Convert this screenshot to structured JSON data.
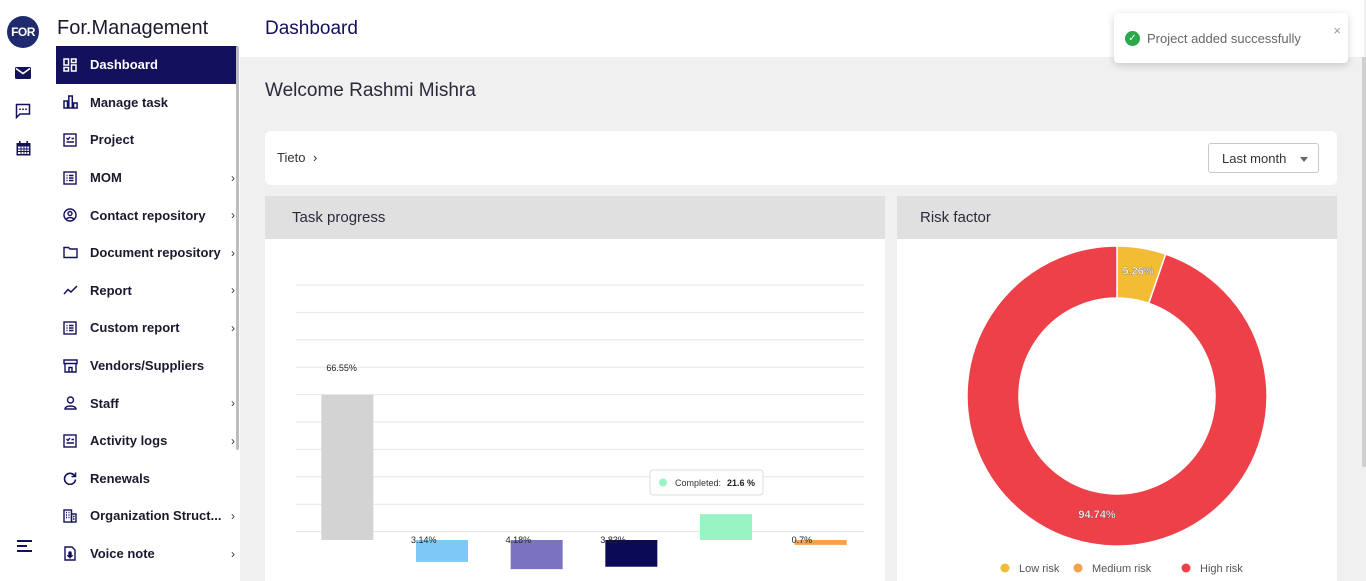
{
  "rail": {
    "logo": "FOR",
    "icons": [
      "mail-icon",
      "chat-icon",
      "calendar-icon",
      "menu-icon"
    ]
  },
  "app": {
    "name": "For.Management"
  },
  "sidebar": {
    "items": [
      {
        "label": "Dashboard",
        "icon": "dashboard-icon",
        "active": true,
        "chevron": false
      },
      {
        "label": "Manage task",
        "icon": "bar-chart-icon",
        "active": false,
        "chevron": false
      },
      {
        "label": "Project",
        "icon": "checklist-icon",
        "active": false,
        "chevron": false
      },
      {
        "label": "MOM",
        "icon": "list-icon",
        "active": false,
        "chevron": true
      },
      {
        "label": "Contact repository",
        "icon": "contact-icon",
        "active": false,
        "chevron": true
      },
      {
        "label": "Document repository",
        "icon": "folder-icon",
        "active": false,
        "chevron": true
      },
      {
        "label": "Report",
        "icon": "trend-icon",
        "active": false,
        "chevron": true
      },
      {
        "label": "Custom report",
        "icon": "list-icon",
        "active": false,
        "chevron": true
      },
      {
        "label": "Vendors/Suppliers",
        "icon": "store-icon",
        "active": false,
        "chevron": false
      },
      {
        "label": "Staff",
        "icon": "person-icon",
        "active": false,
        "chevron": true
      },
      {
        "label": "Activity logs",
        "icon": "checklist-icon",
        "active": false,
        "chevron": true
      },
      {
        "label": "Renewals",
        "icon": "renew-icon",
        "active": false,
        "chevron": false
      },
      {
        "label": "Organization Struct...",
        "icon": "building-icon",
        "active": false,
        "chevron": true
      },
      {
        "label": "Voice note",
        "icon": "voice-note-icon",
        "active": false,
        "chevron": true
      }
    ]
  },
  "header": {
    "title": "Dashboard"
  },
  "welcome": "Welcome Rashmi Mishra",
  "filter": {
    "breadcrumb": "Tieto",
    "period": "Last month"
  },
  "toast": {
    "message": "Project added successfully",
    "close": "×"
  },
  "colors": {
    "primary": "#13105c",
    "risk_high": "#ee4049",
    "risk_medium": "#f5a04a",
    "risk_low": "#f2bd35"
  },
  "cards": {
    "task_progress": {
      "title": "Task progress"
    },
    "risk_factor": {
      "title": "Risk factor"
    }
  },
  "chart_data": [
    {
      "type": "bar",
      "title": "Task progress",
      "subtype": "waterfall",
      "categories": [
        "",
        "",
        "",
        "",
        "",
        ""
      ],
      "values": [
        66.55,
        -3.14,
        -4.18,
        -3.83,
        21.6,
        -0.7
      ],
      "labels": [
        "66.55%",
        "3.14%",
        "4.18%",
        "3.83%",
        "21.5%",
        "0.7%"
      ],
      "colors": [
        "#d3d3d3",
        "#7ec8f8",
        "#7a74c0",
        "#0b0a55",
        "#98f5c3",
        "#f5a04a"
      ],
      "tooltip": {
        "label": "Completed:",
        "value": "21.6 %"
      },
      "grid": true
    },
    {
      "type": "pie",
      "title": "Risk factor",
      "donut": true,
      "slices": [
        {
          "name": "Low risk",
          "value": 5.26,
          "label": "5.26%",
          "color": "#f2bd35"
        },
        {
          "name": "Medium risk",
          "value": 0,
          "label": "",
          "color": "#f5a04a"
        },
        {
          "name": "High risk",
          "value": 94.74,
          "label": "94.74%",
          "color": "#ee4049"
        }
      ],
      "legend": "bottom"
    }
  ]
}
